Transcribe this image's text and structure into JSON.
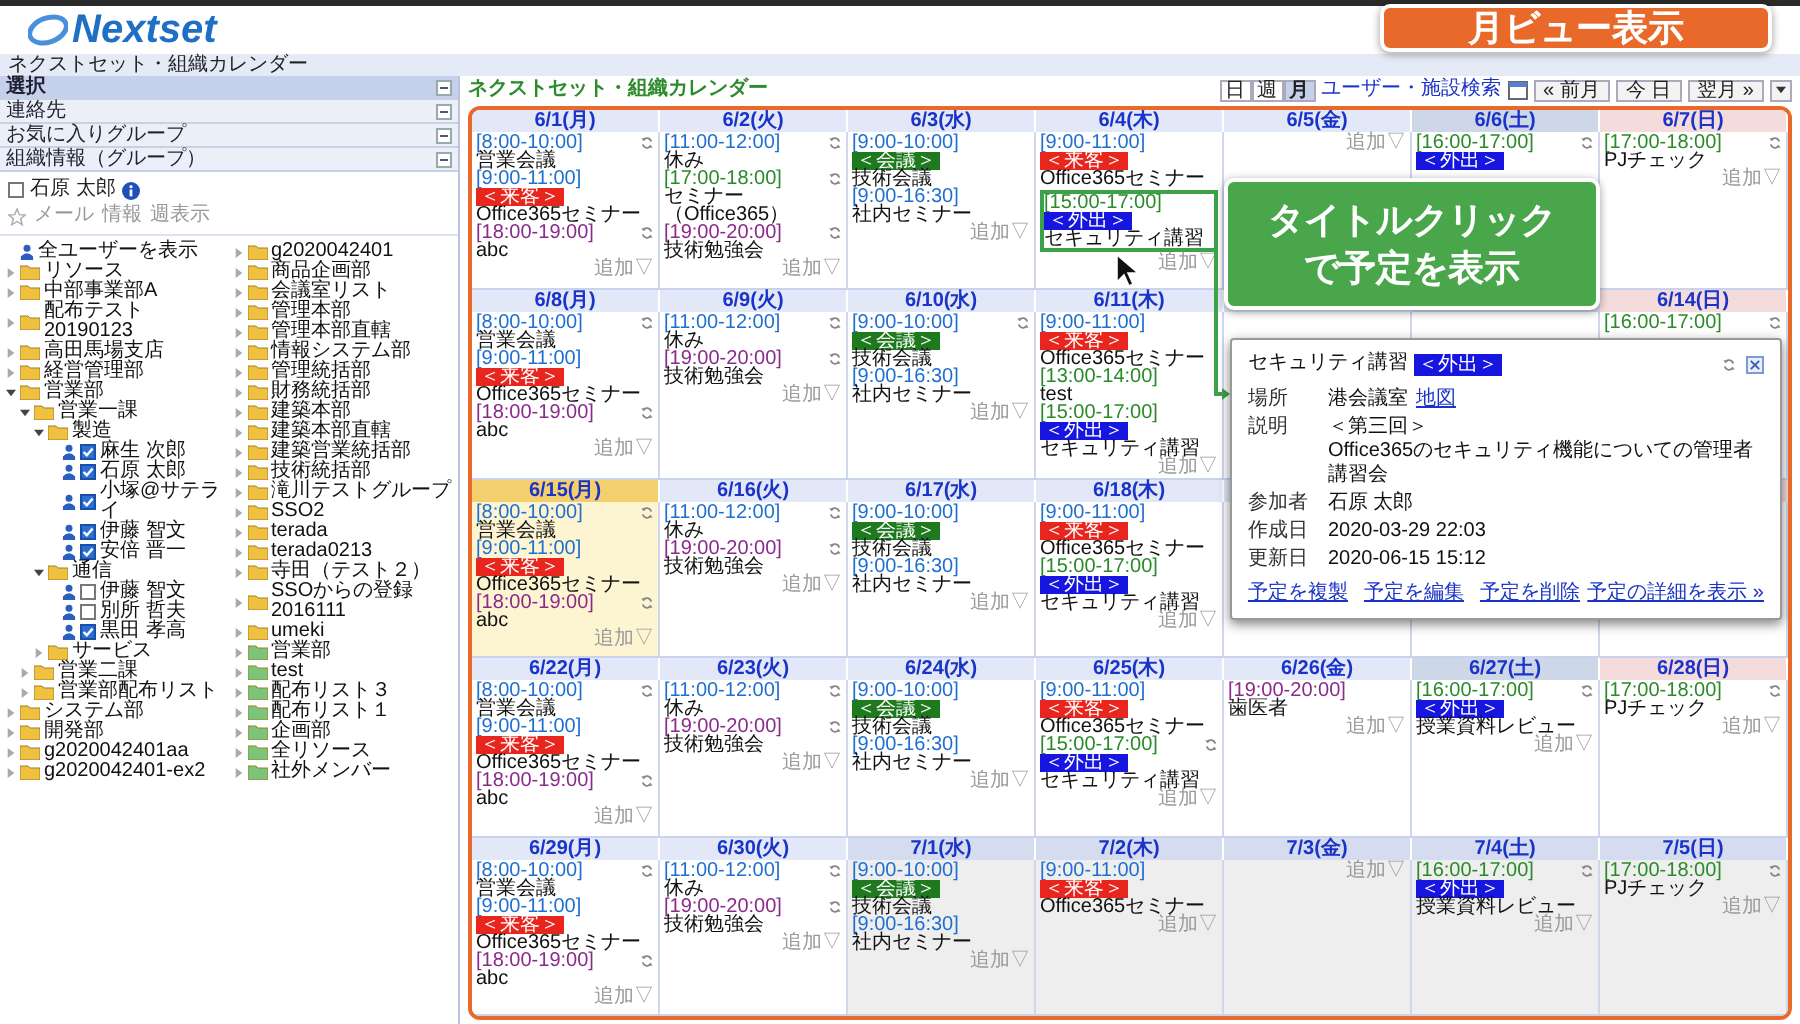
{
  "logo": "Nextset",
  "breadcrumb": "ネクストセット・組織カレンダー",
  "annotations": {
    "view_label": "月ビュー表示",
    "click_hint": [
      "タイトルクリック",
      "で予定を表示"
    ]
  },
  "sidebar": {
    "panels": [
      {
        "label": "選択",
        "selected": true
      },
      {
        "label": "連絡先",
        "selected": false
      },
      {
        "label": "お気に入りグループ",
        "selected": false
      },
      {
        "label": "組織情報（グループ）",
        "selected": false
      }
    ],
    "user": {
      "name": "石原 太郎",
      "checked": false,
      "links": [
        "メール",
        "情報",
        "週表示"
      ]
    },
    "tree": [
      {
        "label": "全ユーザーを表示",
        "kind": "all_users"
      },
      {
        "label": "リソース",
        "kind": "folder",
        "expanded": false
      },
      {
        "label": "中部事業部A",
        "kind": "folder",
        "expanded": false
      },
      {
        "label": "配布テスト20190123",
        "kind": "folder",
        "expanded": false
      },
      {
        "label": "高田馬場支店",
        "kind": "folder",
        "expanded": false
      },
      {
        "label": "経営管理部",
        "kind": "folder",
        "expanded": false
      },
      {
        "label": "営業部",
        "kind": "folder",
        "expanded": true,
        "children": [
          {
            "label": "営業一課",
            "kind": "folder",
            "expanded": true,
            "children": [
              {
                "label": "製造",
                "kind": "folder",
                "expanded": true,
                "children": [
                  {
                    "label": "麻生 次郎",
                    "kind": "user",
                    "checked": true
                  },
                  {
                    "label": "石原 太郎",
                    "kind": "user",
                    "checked": true
                  },
                  {
                    "label": "小塚@サテライ",
                    "kind": "user",
                    "checked": true
                  },
                  {
                    "label": "伊藤 智文",
                    "kind": "user",
                    "checked": true
                  },
                  {
                    "label": "安倍 晋一",
                    "kind": "user",
                    "checked": true
                  }
                ]
              },
              {
                "label": "通信",
                "kind": "folder",
                "expanded": true,
                "children": [
                  {
                    "label": "伊藤 智文",
                    "kind": "user",
                    "checked": false
                  },
                  {
                    "label": "別所 哲夫",
                    "kind": "user",
                    "checked": false
                  },
                  {
                    "label": "黒田 孝高",
                    "kind": "user",
                    "checked": true
                  }
                ]
              },
              {
                "label": "サービス",
                "kind": "folder",
                "expanded": false
              }
            ]
          },
          {
            "label": "営業二課",
            "kind": "folder",
            "expanded": false
          },
          {
            "label": "営業部配布リスト",
            "kind": "folder",
            "expanded": false
          }
        ]
      },
      {
        "label": "システム部",
        "kind": "folder",
        "expanded": false
      },
      {
        "label": "開発部",
        "kind": "folder",
        "expanded": false
      },
      {
        "label": "g2020042401aa",
        "kind": "folder",
        "expanded": false
      },
      {
        "label": "g2020042401-ex2",
        "kind": "folder",
        "expanded": false
      },
      {
        "label": "g2020042401",
        "kind": "folder",
        "expanded": false
      },
      {
        "label": "商品企画部",
        "kind": "folder",
        "expanded": false
      },
      {
        "label": "会議室リスト",
        "kind": "folder",
        "expanded": false
      },
      {
        "label": "管理本部",
        "kind": "folder",
        "expanded": false
      },
      {
        "label": "管理本部直轄",
        "kind": "folder",
        "expanded": false
      },
      {
        "label": "情報システム部",
        "kind": "folder",
        "expanded": false
      },
      {
        "label": "管理統括部",
        "kind": "folder",
        "expanded": false
      },
      {
        "label": "財務統括部",
        "kind": "folder",
        "expanded": false
      },
      {
        "label": "建築本部",
        "kind": "folder",
        "expanded": false
      },
      {
        "label": "建築本部直轄",
        "kind": "folder",
        "expanded": false
      },
      {
        "label": "建築営業統括部",
        "kind": "folder",
        "expanded": false
      },
      {
        "label": "技術統括部",
        "kind": "folder",
        "expanded": false
      },
      {
        "label": "滝川テストグループ",
        "kind": "folder",
        "expanded": false
      },
      {
        "label": "SSO2",
        "kind": "folder",
        "expanded": false
      },
      {
        "label": "terada",
        "kind": "folder",
        "expanded": false
      },
      {
        "label": "terada0213",
        "kind": "folder",
        "expanded": false
      },
      {
        "label": "寺田（テスト２）",
        "kind": "folder",
        "expanded": false
      },
      {
        "label": "SSOからの登録2016111",
        "kind": "folder",
        "expanded": false
      },
      {
        "label": "umeki",
        "kind": "folder",
        "expanded": false
      },
      {
        "label": "営業部",
        "kind": "shared",
        "expanded": false
      },
      {
        "label": "test",
        "kind": "shared",
        "expanded": false
      },
      {
        "label": "配布リスト３",
        "kind": "shared",
        "expanded": false
      },
      {
        "label": "配布リスト１",
        "kind": "shared",
        "expanded": false
      },
      {
        "label": "企画部",
        "kind": "shared",
        "expanded": false
      },
      {
        "label": "全リソース",
        "kind": "shared",
        "expanded": false
      },
      {
        "label": "社外メンバー",
        "kind": "shared",
        "expanded": false
      }
    ]
  },
  "toolbar": {
    "title": "ネクストセット・組織カレンダー",
    "views": [
      {
        "label": "日",
        "selected": false
      },
      {
        "label": "週",
        "selected": false
      },
      {
        "label": "月",
        "selected": true
      }
    ],
    "search_link": "ユーザー・施設検索",
    "nav": [
      "« 前月",
      "今 日",
      "翌月 »"
    ]
  },
  "calendar": {
    "weeks": [
      {
        "days": [
          {
            "date": "6/1(月)",
            "kind": "weekday",
            "today": false,
            "other_month": false,
            "events": [
              {
                "time": "[8:00-10:00]",
                "color": "#1e6fd0",
                "title": "営業会議",
                "repeat": true,
                "highlighted": false
              },
              {
                "time": "[9:00-11:00]",
                "color": "#1e6fd0",
                "tag": {
                  "text": "＜来客＞",
                  "kind": "visitor"
                },
                "title": "Office365セミナー",
                "repeat": false,
                "highlighted": false
              },
              {
                "time": "[18:00-19:00]",
                "color": "#8a2a8a",
                "title": "abc",
                "repeat": true,
                "highlighted": false
              }
            ],
            "add_label": "追加▽"
          },
          {
            "date": "6/2(火)",
            "kind": "weekday",
            "today": false,
            "other_month": false,
            "events": [
              {
                "time": "[11:00-12:00]",
                "color": "#1e6fd0",
                "title": "休み",
                "repeat": true,
                "highlighted": false
              },
              {
                "time": "[17:00-18:00]",
                "color": "#2a8a2a",
                "title": "セミナー（Office365）",
                "repeat": true,
                "highlighted": false
              },
              {
                "time": "[19:00-20:00]",
                "color": "#8a2a8a",
                "title": "技術勉強会",
                "repeat": true,
                "highlighted": false
              }
            ],
            "add_label": "追加▽"
          },
          {
            "date": "6/3(水)",
            "kind": "weekday",
            "today": false,
            "other_month": false,
            "events": [
              {
                "time": "[9:00-10:00]",
                "color": "#1e6fd0",
                "tag": {
                  "text": "＜会議＞",
                  "kind": "meeting"
                },
                "title": "技術会議",
                "repeat": false,
                "highlighted": false
              },
              {
                "time": "[9:00-16:30]",
                "color": "#1e6fd0",
                "title": "社内セミナー",
                "repeat": false,
                "highlighted": false
              }
            ],
            "add_label": "追加▽"
          },
          {
            "date": "6/4(木)",
            "kind": "weekday",
            "today": false,
            "other_month": false,
            "events": [
              {
                "time": "[9:00-11:00]",
                "color": "#1e6fd0",
                "tag": {
                  "text": "＜来客＞",
                  "kind": "visitor"
                },
                "title": "Office365セミナー",
                "repeat": false,
                "highlighted": false
              },
              {
                "time": "[15:00-17:00]",
                "color": "#2a8a2a",
                "tag": {
                  "text": "＜外出＞",
                  "kind": "outing"
                },
                "title": "セキュリティ講習",
                "repeat": false,
                "highlighted": true
              }
            ],
            "add_label": "追加▽"
          },
          {
            "date": "6/5(金)",
            "kind": "weekday",
            "today": false,
            "other_month": false,
            "add_label": "追加▽"
          },
          {
            "date": "6/6(土)",
            "kind": "saturday",
            "today": false,
            "other_month": false,
            "events": [
              {
                "time": "[16:00-17:00]",
                "color": "#2a8a2a",
                "tag": {
                  "text": "＜外出＞",
                  "kind": "outing"
                },
                "repeat": true,
                "highlighted": false
              }
            ]
          },
          {
            "date": "6/7(日)",
            "kind": "sunday",
            "today": false,
            "other_month": false,
            "events": [
              {
                "time": "[17:00-18:00]",
                "color": "#2a8a2a",
                "title": "PJチェック",
                "repeat": true,
                "highlighted": false
              }
            ],
            "add_label": "追加▽"
          }
        ]
      },
      {
        "days": [
          {
            "date": "6/8(月)",
            "kind": "weekday",
            "today": false,
            "other_month": false,
            "events": [
              {
                "time": "[8:00-10:00]",
                "color": "#1e6fd0",
                "title": "営業会議",
                "repeat": true,
                "highlighted": false
              },
              {
                "time": "[9:00-11:00]",
                "color": "#1e6fd0",
                "tag": {
                  "text": "＜来客＞",
                  "kind": "visitor"
                },
                "title": "Office365セミナー",
                "repeat": false,
                "highlighted": false
              },
              {
                "time": "[18:00-19:00]",
                "color": "#8a2a8a",
                "title": "abc",
                "repeat": true,
                "highlighted": false
              }
            ],
            "add_label": "追加▽"
          },
          {
            "date": "6/9(火)",
            "kind": "weekday",
            "today": false,
            "other_month": false,
            "events": [
              {
                "time": "[11:00-12:00]",
                "color": "#1e6fd0",
                "title": "休み",
                "repeat": true,
                "highlighted": false
              },
              {
                "time": "[19:00-20:00]",
                "color": "#8a2a8a",
                "title": "技術勉強会",
                "repeat": true,
                "highlighted": false
              }
            ],
            "add_label": "追加▽"
          },
          {
            "date": "6/10(水)",
            "kind": "weekday",
            "today": false,
            "other_month": false,
            "events": [
              {
                "time": "[9:00-10:00]",
                "color": "#1e6fd0",
                "tag": {
                  "text": "＜会議＞",
                  "kind": "meeting"
                },
                "title": "技術会議",
                "repeat": true,
                "highlighted": false
              },
              {
                "time": "[9:00-16:30]",
                "color": "#1e6fd0",
                "title": "社内セミナー",
                "repeat": false,
                "highlighted": false
              }
            ],
            "add_label": "追加▽"
          },
          {
            "date": "6/11(木)",
            "kind": "weekday",
            "today": false,
            "other_month": false,
            "events": [
              {
                "time": "[9:00-11:00]",
                "color": "#1e6fd0",
                "tag": {
                  "text": "＜来客＞",
                  "kind": "visitor"
                },
                "title": "Office365セミナー",
                "repeat": false,
                "highlighted": false
              },
              {
                "time": "[13:00-14:00]",
                "color": "#2a8a2a",
                "title": "test",
                "repeat": false,
                "highlighted": false
              },
              {
                "time": "[15:00-17:00]",
                "color": "#2a8a2a",
                "tag": {
                  "text": "＜外出＞",
                  "kind": "outing"
                },
                "title": "セキュリティ講習",
                "repeat": false,
                "highlighted": false
              }
            ],
            "add_label": "追加▽"
          },
          {
            "kind": "weekday"
          },
          {
            "kind": "saturday"
          },
          {
            "date": "6/14(日)",
            "kind": "sunday",
            "today": false,
            "other_month": false,
            "events": [
              {
                "time": "[16:00-17:00]",
                "color": "#2a8a2a",
                "repeat": true,
                "highlighted": false
              }
            ]
          }
        ]
      },
      {
        "days": [
          {
            "date": "6/15(月)",
            "kind": "weekday",
            "today": true,
            "other_month": false,
            "events": [
              {
                "time": "[8:00-10:00]",
                "color": "#1e6fd0",
                "title": "営業会議",
                "repeat": true,
                "highlighted": false
              },
              {
                "time": "[9:00-11:00]",
                "color": "#1e6fd0",
                "tag": {
                  "text": "＜来客＞",
                  "kind": "visitor"
                },
                "title": "Office365セミナー",
                "repeat": false,
                "highlighted": false
              },
              {
                "time": "[18:00-19:00]",
                "color": "#8a2a8a",
                "title": "abc",
                "repeat": true,
                "highlighted": false
              }
            ],
            "add_label": "追加▽"
          },
          {
            "date": "6/16(火)",
            "kind": "weekday",
            "today": false,
            "other_month": false,
            "events": [
              {
                "time": "[11:00-12:00]",
                "color": "#1e6fd0",
                "title": "休み",
                "repeat": true,
                "highlighted": false
              },
              {
                "time": "[19:00-20:00]",
                "color": "#8a2a8a",
                "title": "技術勉強会",
                "repeat": true,
                "highlighted": false
              }
            ],
            "add_label": "追加▽"
          },
          {
            "date": "6/17(水)",
            "kind": "weekday",
            "today": false,
            "other_month": false,
            "events": [
              {
                "time": "[9:00-10:00]",
                "color": "#1e6fd0",
                "tag": {
                  "text": "＜会議＞",
                  "kind": "meeting"
                },
                "title": "技術会議",
                "repeat": false,
                "highlighted": false
              },
              {
                "time": "[9:00-16:30]",
                "color": "#1e6fd0",
                "title": "社内セミナー",
                "repeat": false,
                "highlighted": false
              }
            ],
            "add_label": "追加▽"
          },
          {
            "date": "6/18(木)",
            "kind": "weekday",
            "today": false,
            "other_month": false,
            "events": [
              {
                "time": "[9:00-11:00]",
                "color": "#1e6fd0",
                "tag": {
                  "text": "＜来客＞",
                  "kind": "visitor"
                },
                "title": "Office365セミナー",
                "repeat": false,
                "highlighted": false
              },
              {
                "time": "[15:00-17:00]",
                "color": "#2a8a2a",
                "tag": {
                  "text": "＜外出＞",
                  "kind": "outing"
                },
                "title": "セキュリティ講習",
                "repeat": false,
                "highlighted": false
              }
            ],
            "add_label": "追加▽"
          },
          {
            "kind": "weekday"
          },
          {
            "kind": "saturday"
          },
          {
            "kind": "sunday"
          }
        ]
      },
      {
        "days": [
          {
            "date": "6/22(月)",
            "kind": "weekday",
            "today": false,
            "other_month": false,
            "events": [
              {
                "time": "[8:00-10:00]",
                "color": "#1e6fd0",
                "title": "営業会議",
                "repeat": true,
                "highlighted": false
              },
              {
                "time": "[9:00-11:00]",
                "color": "#1e6fd0",
                "tag": {
                  "text": "＜来客＞",
                  "kind": "visitor"
                },
                "title": "Office365セミナー",
                "repeat": false,
                "highlighted": false
              },
              {
                "time": "[18:00-19:00]",
                "color": "#8a2a8a",
                "title": "abc",
                "repeat": true,
                "highlighted": false
              }
            ],
            "add_label": "追加▽"
          },
          {
            "date": "6/23(火)",
            "kind": "weekday",
            "today": false,
            "other_month": false,
            "events": [
              {
                "time": "[11:00-12:00]",
                "color": "#1e6fd0",
                "title": "休み",
                "repeat": true,
                "highlighted": false
              },
              {
                "time": "[19:00-20:00]",
                "color": "#8a2a8a",
                "title": "技術勉強会",
                "repeat": true,
                "highlighted": false
              }
            ],
            "add_label": "追加▽"
          },
          {
            "date": "6/24(水)",
            "kind": "weekday",
            "today": false,
            "other_month": false,
            "events": [
              {
                "time": "[9:00-10:00]",
                "color": "#1e6fd0",
                "tag": {
                  "text": "＜会議＞",
                  "kind": "meeting"
                },
                "title": "技術会議",
                "repeat": false,
                "highlighted": false
              },
              {
                "time": "[9:00-16:30]",
                "color": "#1e6fd0",
                "title": "社内セミナー",
                "repeat": false,
                "highlighted": false
              }
            ],
            "add_label": "追加▽"
          },
          {
            "date": "6/25(木)",
            "kind": "weekday",
            "today": false,
            "other_month": false,
            "events": [
              {
                "time": "[9:00-11:00]",
                "color": "#1e6fd0",
                "tag": {
                  "text": "＜来客＞",
                  "kind": "visitor"
                },
                "title": "Office365セミナー",
                "repeat": false,
                "highlighted": false
              },
              {
                "time": "[15:00-17:00]",
                "color": "#2a8a2a",
                "tag": {
                  "text": "＜外出＞",
                  "kind": "outing"
                },
                "title": "セキュリティ講習",
                "repeat": true,
                "highlighted": false
              }
            ],
            "add_label": "追加▽"
          },
          {
            "date": "6/26(金)",
            "kind": "weekday",
            "today": false,
            "other_month": false,
            "events": [
              {
                "time": "[19:00-20:00]",
                "color": "#8a2a8a",
                "title": "歯医者",
                "repeat": false,
                "highlighted": false
              }
            ],
            "add_label": "追加▽"
          },
          {
            "date": "6/27(土)",
            "kind": "saturday",
            "today": false,
            "other_month": false,
            "events": [
              {
                "time": "[16:00-17:00]",
                "color": "#2a8a2a",
                "tag": {
                  "text": "＜外出＞",
                  "kind": "outing"
                },
                "title": "授業資料レビュー",
                "repeat": true,
                "highlighted": false
              }
            ],
            "add_label": "追加▽"
          },
          {
            "date": "6/28(日)",
            "kind": "sunday",
            "today": false,
            "other_month": false,
            "events": [
              {
                "time": "[17:00-18:00]",
                "color": "#2a8a2a",
                "title": "PJチェック",
                "repeat": true,
                "highlighted": false
              }
            ],
            "add_label": "追加▽"
          }
        ]
      },
      {
        "days": [
          {
            "date": "6/29(月)",
            "kind": "weekday",
            "today": false,
            "other_month": false,
            "events": [
              {
                "time": "[8:00-10:00]",
                "color": "#1e6fd0",
                "title": "営業会議",
                "repeat": true,
                "highlighted": false
              },
              {
                "time": "[9:00-11:00]",
                "color": "#1e6fd0",
                "tag": {
                  "text": "＜来客＞",
                  "kind": "visitor"
                },
                "title": "Office365セミナー",
                "repeat": false,
                "highlighted": false
              },
              {
                "time": "[18:00-19:00]",
                "color": "#8a2a8a",
                "title": "abc",
                "repeat": true,
                "highlighted": false
              }
            ],
            "add_label": "追加▽"
          },
          {
            "date": "6/30(火)",
            "kind": "weekday",
            "today": false,
            "other_month": false,
            "events": [
              {
                "time": "[11:00-12:00]",
                "color": "#1e6fd0",
                "title": "休み",
                "repeat": true,
                "highlighted": false
              },
              {
                "time": "[19:00-20:00]",
                "color": "#8a2a8a",
                "title": "技術勉強会",
                "repeat": true,
                "highlighted": false
              }
            ],
            "add_label": "追加▽"
          },
          {
            "date": "7/1(水)",
            "kind": "weekday",
            "today": false,
            "other_month": true,
            "events": [
              {
                "time": "[9:00-10:00]",
                "color": "#1e6fd0",
                "tag": {
                  "text": "＜会議＞",
                  "kind": "meeting"
                },
                "title": "技術会議",
                "repeat": false,
                "highlighted": false
              },
              {
                "time": "[9:00-16:30]",
                "color": "#1e6fd0",
                "title": "社内セミナー",
                "repeat": false,
                "highlighted": false
              }
            ],
            "add_label": "追加▽"
          },
          {
            "date": "7/2(木)",
            "kind": "weekday",
            "today": false,
            "other_month": true,
            "events": [
              {
                "time": "[9:00-11:00]",
                "color": "#1e6fd0",
                "tag": {
                  "text": "＜来客＞",
                  "kind": "visitor"
                },
                "title": "Office365セミナー",
                "repeat": false,
                "highlighted": false
              }
            ],
            "add_label": "追加▽"
          },
          {
            "date": "7/3(金)",
            "kind": "weekday",
            "today": false,
            "other_month": true,
            "add_label": "追加▽"
          },
          {
            "date": "7/4(土)",
            "kind": "saturday",
            "today": false,
            "other_month": true,
            "events": [
              {
                "time": "[16:00-17:00]",
                "color": "#2a8a2a",
                "tag": {
                  "text": "＜外出＞",
                  "kind": "outing"
                },
                "title": "授業資料レビュー",
                "repeat": true,
                "highlighted": false
              }
            ],
            "add_label": "追加▽"
          },
          {
            "date": "7/5(日)",
            "kind": "sunday",
            "today": false,
            "other_month": true,
            "events": [
              {
                "time": "[17:00-18:00]",
                "color": "#2a8a2a",
                "title": "PJチェック",
                "repeat": true,
                "highlighted": false
              }
            ],
            "add_label": "追加▽"
          }
        ]
      }
    ]
  },
  "popup": {
    "title": "セキュリティ講習",
    "tag": {
      "text": "＜外出＞",
      "kind": "outing"
    },
    "fields": [
      {
        "label": "場所",
        "lines": [
          "港会議室"
        ],
        "link": "地図"
      },
      {
        "label": "説明",
        "lines": [
          "＜第三回＞",
          "Office365のセキュリティ機能についての管理者講習会"
        ]
      },
      {
        "label": "参加者",
        "lines": [
          "石原 太郎"
        ]
      },
      {
        "label": "作成日",
        "lines": [
          "2020-03-29 22:03"
        ]
      },
      {
        "label": "更新日",
        "lines": [
          "2020-06-15 15:12"
        ]
      }
    ],
    "actions": [
      "予定を複製",
      "予定を編集",
      "予定を削除"
    ],
    "detail_link": "予定の詳細を表示 »"
  }
}
